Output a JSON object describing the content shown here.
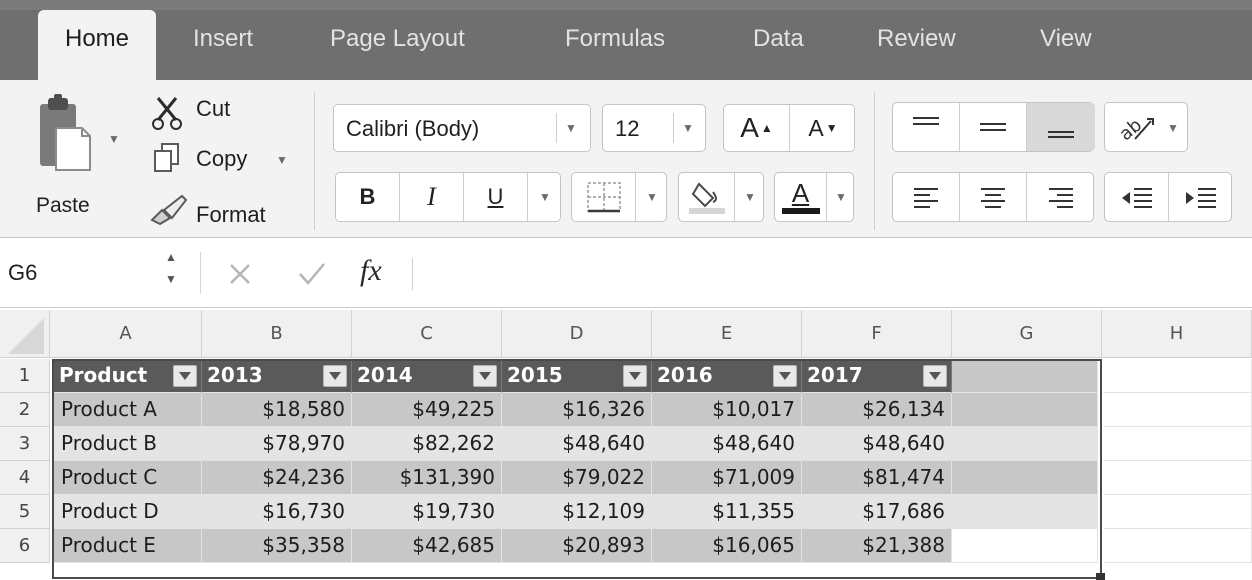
{
  "tabs": [
    {
      "label": "Home",
      "active": true
    },
    {
      "label": "Insert"
    },
    {
      "label": "Page Layout"
    },
    {
      "label": "Formulas"
    },
    {
      "label": "Data"
    },
    {
      "label": "Review"
    },
    {
      "label": "View"
    }
  ],
  "clipboard": {
    "paste_label": "Paste",
    "cut_label": "Cut",
    "copy_label": "Copy",
    "format_label": "Format",
    "icons": {
      "paste": "clipboard-icon",
      "cut": "scissors-icon",
      "copy": "copy-icon",
      "format": "paintbrush-icon"
    }
  },
  "font": {
    "name": "Calibri (Body)",
    "size": "12",
    "grow_label": "A",
    "shrink_label": "A",
    "bold_label": "B",
    "italic_label": "I",
    "underline_label": "U",
    "font_color_label": "A",
    "icons": {
      "border": "borders-icon",
      "fill": "fill-color-icon"
    }
  },
  "alignment": {
    "icons": [
      "align-top-icon",
      "align-middle-icon",
      "align-bottom-icon",
      "orientation-icon",
      "align-left-icon",
      "align-center-icon",
      "align-right-icon",
      "decrease-indent-icon",
      "increase-indent-icon"
    ]
  },
  "formula_bar": {
    "name_box": "G6",
    "fx_label": "fx",
    "formula": ""
  },
  "columns": [
    "A",
    "B",
    "C",
    "D",
    "E",
    "F",
    "G",
    "H"
  ],
  "rows": [
    "1",
    "2",
    "3",
    "4",
    "5",
    "6"
  ],
  "table": {
    "headers": [
      "Product",
      "2013",
      "2014",
      "2015",
      "2016",
      "2017"
    ],
    "rows": [
      [
        "Product A",
        "$18,580",
        "$49,225",
        "$16,326",
        "$10,017",
        "$26,134"
      ],
      [
        "Product B",
        "$78,970",
        "$82,262",
        "$48,640",
        "$48,640",
        "$48,640"
      ],
      [
        "Product C",
        "$24,236",
        "$131,390",
        "$79,022",
        "$71,009",
        "$81,474"
      ],
      [
        "Product D",
        "$16,730",
        "$19,730",
        "$12,109",
        "$11,355",
        "$17,686"
      ],
      [
        "Product E",
        "$35,358",
        "$42,685",
        "$20,893",
        "$16,065",
        "$21,388"
      ]
    ]
  }
}
